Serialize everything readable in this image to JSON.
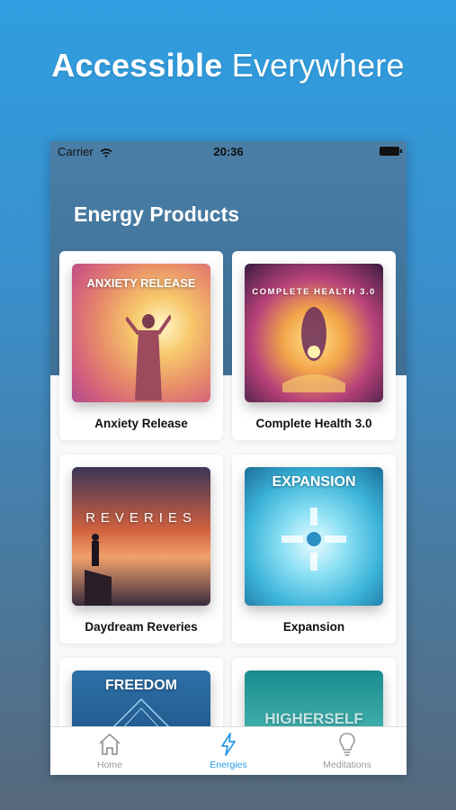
{
  "banner": {
    "bold": "Accessible",
    "light": "Everywhere"
  },
  "status_bar": {
    "carrier": "Carrier",
    "time": "20:36"
  },
  "screen": {
    "title": "Energy Products"
  },
  "products": [
    {
      "name": "Anxiety Release",
      "art_text": "ANXIETY RELEASE"
    },
    {
      "name": "Complete Health 3.0",
      "art_text": "COMPLETE HEALTH 3.0"
    },
    {
      "name": "Daydream Reveries",
      "art_text": "REVERIES"
    },
    {
      "name": "Expansion",
      "art_text": "EXPANSION"
    },
    {
      "name": "",
      "art_text": "FREEDOM"
    },
    {
      "name": "",
      "art_text": "HIGHERSELF"
    }
  ],
  "tabs": [
    {
      "label": "Home",
      "icon": "home-icon"
    },
    {
      "label": "Energies",
      "icon": "lightning-icon",
      "active": true
    },
    {
      "label": "Meditations",
      "icon": "lightbulb-icon"
    }
  ],
  "colors": {
    "accent": "#2a9ae6",
    "banner_top": "#2f9ee0",
    "header_bg": "#4a7ea6"
  }
}
